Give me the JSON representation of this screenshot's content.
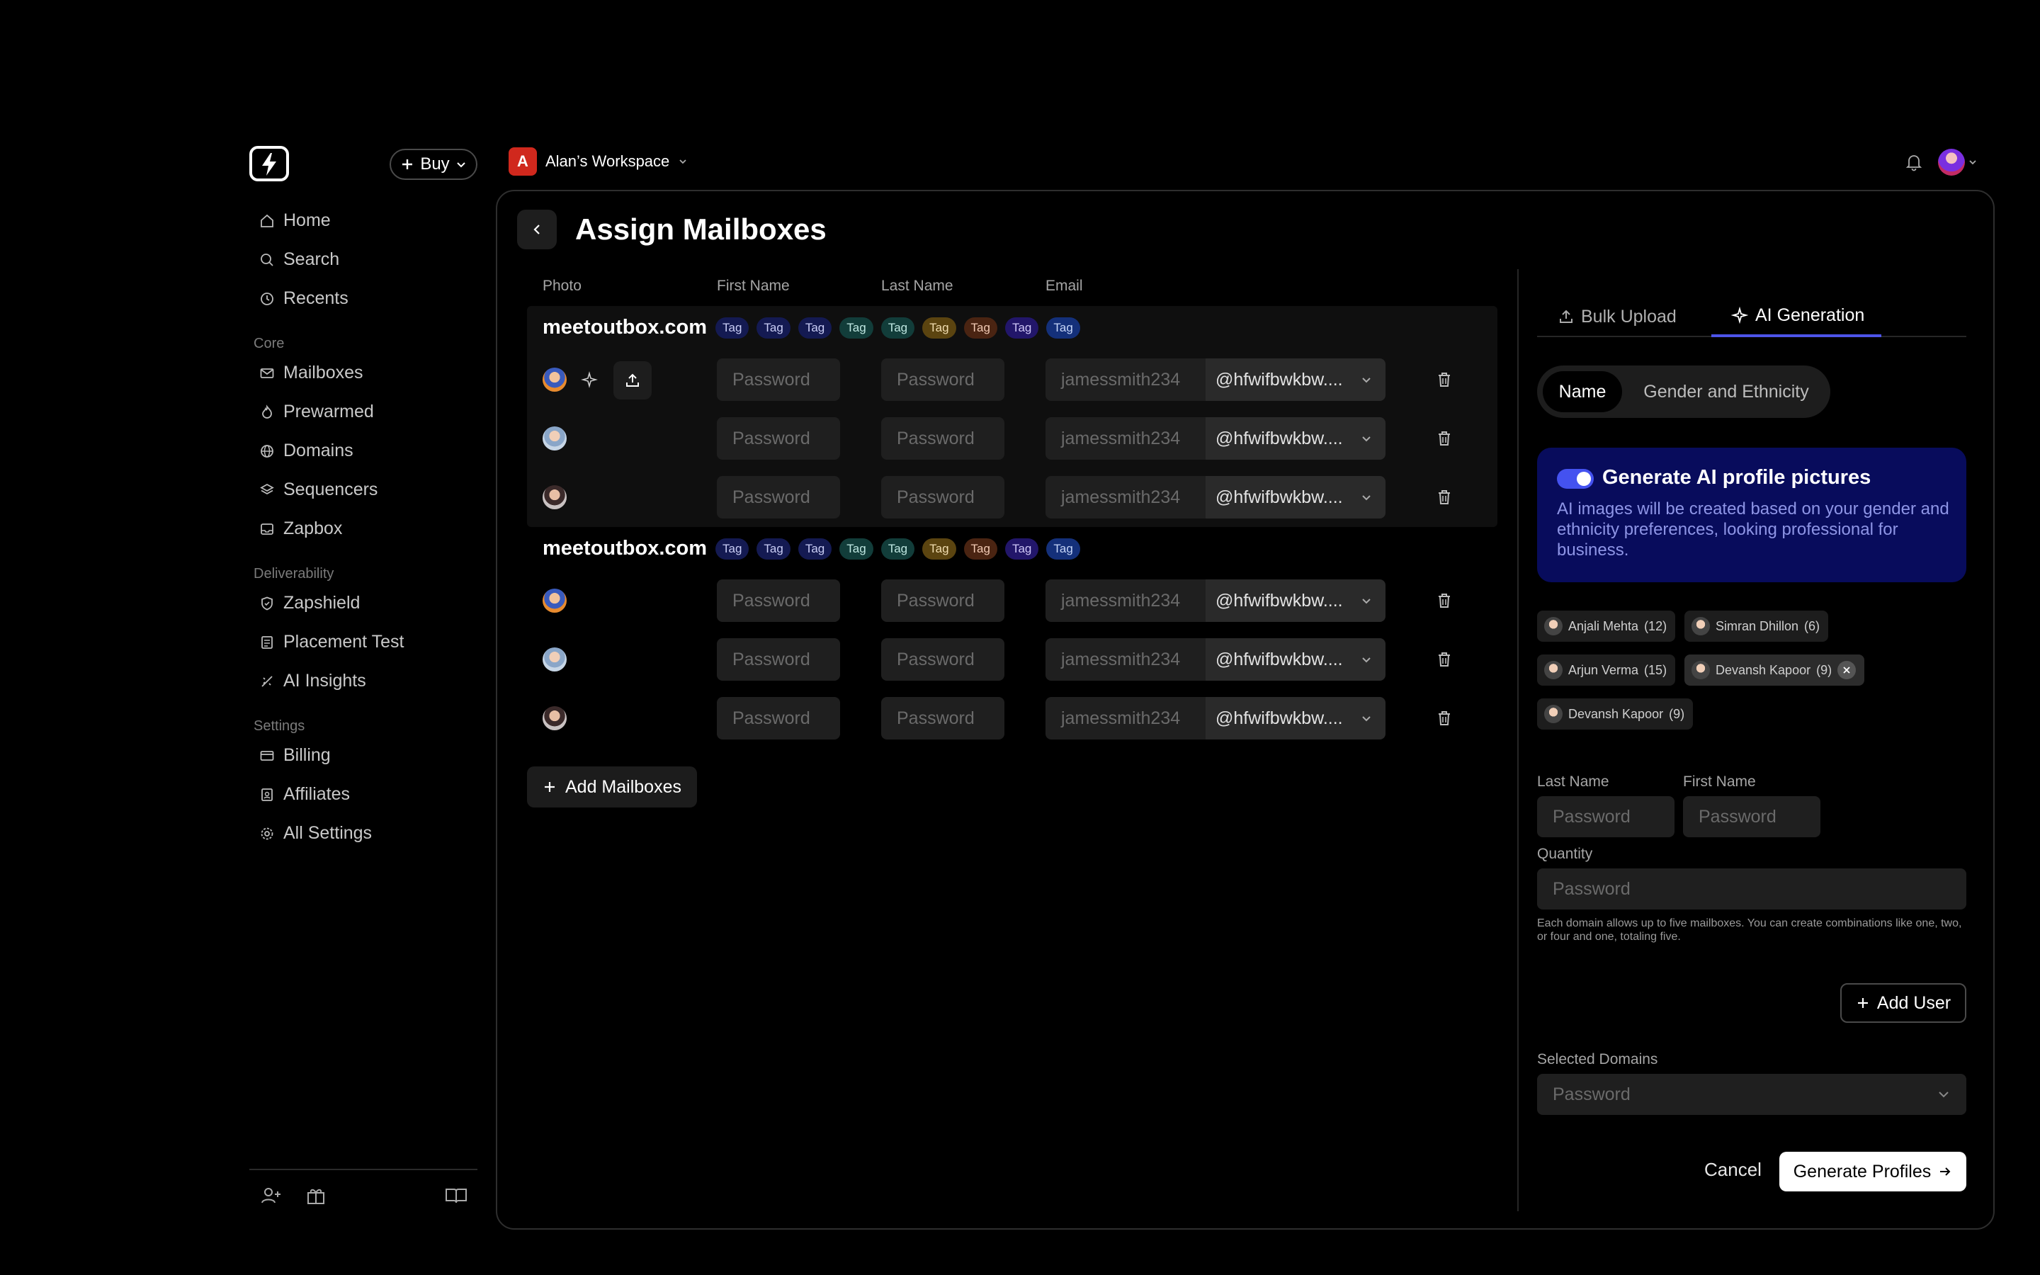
{
  "header": {
    "buy_label": "Buy",
    "workspace_initial": "A",
    "workspace_name": "Alan’s Workspace"
  },
  "sidebar": {
    "top_items": [
      {
        "label": "Home",
        "icon": "home-icon"
      },
      {
        "label": "Search",
        "icon": "search-icon"
      },
      {
        "label": "Recents",
        "icon": "clock-icon"
      }
    ],
    "sections": [
      {
        "title": "Core",
        "items": [
          {
            "label": "Mailboxes",
            "icon": "mail-icon"
          },
          {
            "label": "Prewarmed",
            "icon": "flame-icon"
          },
          {
            "label": "Domains",
            "icon": "globe-icon"
          },
          {
            "label": "Sequencers",
            "icon": "layers-icon"
          },
          {
            "label": "Zapbox",
            "icon": "inbox-icon"
          }
        ]
      },
      {
        "title": "Deliverability",
        "items": [
          {
            "label": "Zapshield",
            "icon": "shield-icon"
          },
          {
            "label": "Placement Test",
            "icon": "test-icon"
          },
          {
            "label": "AI Insights",
            "icon": "insights-icon"
          }
        ]
      },
      {
        "title": "Settings",
        "items": [
          {
            "label": "Billing",
            "icon": "card-icon"
          },
          {
            "label": "Affiliates",
            "icon": "badge-icon"
          },
          {
            "label": "All Settings",
            "icon": "gear-icon"
          }
        ]
      }
    ]
  },
  "page": {
    "title": "Assign Mailboxes",
    "columns": [
      "Photo",
      "First Name",
      "Last Name",
      "Email"
    ],
    "groups": [
      {
        "domain": "meetoutbox.com",
        "tags": [
          "Tag",
          "Tag",
          "Tag",
          "Tag",
          "Tag",
          "Tag",
          "Tag",
          "Tag",
          "Tag"
        ],
        "rows": [
          {
            "first": "Password",
            "last": "Password",
            "email_user": "jamessmith234",
            "email_domain": "@hfwifbwkbw...."
          },
          {
            "first": "Password",
            "last": "Password",
            "email_user": "jamessmith234",
            "email_domain": "@hfwifbwkbw...."
          },
          {
            "first": "Password",
            "last": "Password",
            "email_user": "jamessmith234",
            "email_domain": "@hfwifbwkbw...."
          }
        ]
      },
      {
        "domain": "meetoutbox.com",
        "tags": [
          "Tag",
          "Tag",
          "Tag",
          "Tag",
          "Tag",
          "Tag",
          "Tag",
          "Tag",
          "Tag"
        ],
        "rows": [
          {
            "first": "Password",
            "last": "Password",
            "email_user": "jamessmith234",
            "email_domain": "@hfwifbwkbw...."
          },
          {
            "first": "Password",
            "last": "Password",
            "email_user": "jamessmith234",
            "email_domain": "@hfwifbwkbw...."
          },
          {
            "first": "Password",
            "last": "Password",
            "email_user": "jamessmith234",
            "email_domain": "@hfwifbwkbw...."
          }
        ]
      }
    ],
    "add_mailboxes_label": "Add Mailboxes"
  },
  "tag_colors": [
    {
      "bg": "#141a52",
      "fg": "#c9cdf5"
    },
    {
      "bg": "#141a52",
      "fg": "#c9cdf5"
    },
    {
      "bg": "#141a52",
      "fg": "#c9cdf5"
    },
    {
      "bg": "#123d3a",
      "fg": "#bfe7e1"
    },
    {
      "bg": "#123d3a",
      "fg": "#bfe7e1"
    },
    {
      "bg": "#5b4410",
      "fg": "#f1ddb0"
    },
    {
      "bg": "#4a2412",
      "fg": "#f1c9b3"
    },
    {
      "bg": "#22166a",
      "fg": "#cec6f6"
    },
    {
      "bg": "#14307a",
      "fg": "#c4d4f7"
    }
  ],
  "panel": {
    "tab_bulk": "Bulk Upload",
    "tab_ai": "AI Generation",
    "seg_name": "Name",
    "seg_gender": "Gender and Ethnicity",
    "ai_title": "Generate AI profile pictures",
    "ai_desc": "AI images will be created based on your gender and ethnicity preferences, looking professional for business.",
    "chips": [
      {
        "name": "Anjali Mehta",
        "count": "(12)"
      },
      {
        "name": "Simran Dhillon",
        "count": "(6)"
      },
      {
        "name": "Arjun Verma",
        "count": "(15)"
      },
      {
        "name": "Devansh Kapoor",
        "count": "(9)"
      },
      {
        "name": "Devansh Kapoor",
        "count": "(9)"
      }
    ],
    "last_name_label": "Last Name",
    "first_name_label": "First Name",
    "last_name_placeholder": "Password",
    "first_name_placeholder": "Password",
    "quantity_label": "Quantity",
    "quantity_placeholder": "Password",
    "hint": "Each domain allows up to five mailboxes. You can create combinations like one, two, or four and one, totaling five.",
    "add_user_label": "Add User",
    "selected_domains_label": "Selected Domains",
    "selected_domains_placeholder": "Password",
    "cancel_label": "Cancel",
    "generate_label": "Generate Profiles"
  }
}
